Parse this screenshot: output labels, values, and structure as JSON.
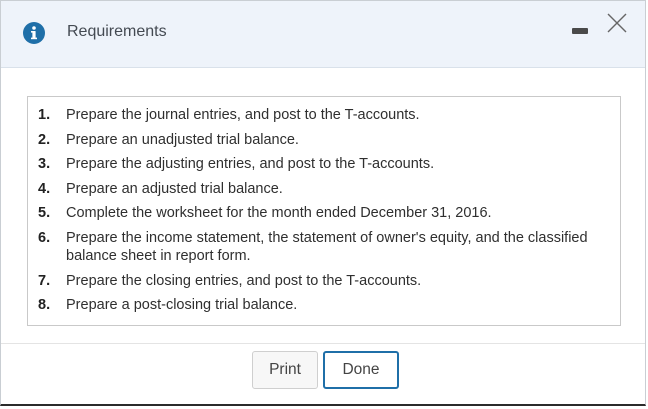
{
  "dialog": {
    "title": "Requirements",
    "info_icon": "info-icon",
    "minimize_icon": "minimize-icon",
    "close_icon": "close-icon",
    "accent_color": "#1f6fa8"
  },
  "requirements": [
    {
      "num": "1.",
      "text": "Prepare the journal entries, and post to the T-accounts."
    },
    {
      "num": "2.",
      "text": "Prepare an unadjusted trial balance."
    },
    {
      "num": "3.",
      "text": "Prepare the adjusting entries, and post to the T-accounts."
    },
    {
      "num": "4.",
      "text": "Prepare an adjusted trial balance."
    },
    {
      "num": "5.",
      "text": "Complete the worksheet for the month ended December 31, 2016."
    },
    {
      "num": "6.",
      "text": "Prepare the income statement, the statement of owner's equity, and the classified balance sheet in report form."
    },
    {
      "num": "7.",
      "text": "Prepare the closing entries, and post to the T-accounts."
    },
    {
      "num": "8.",
      "text": "Prepare a post-closing trial balance."
    }
  ],
  "buttons": {
    "print_label": "Print",
    "done_label": "Done"
  }
}
